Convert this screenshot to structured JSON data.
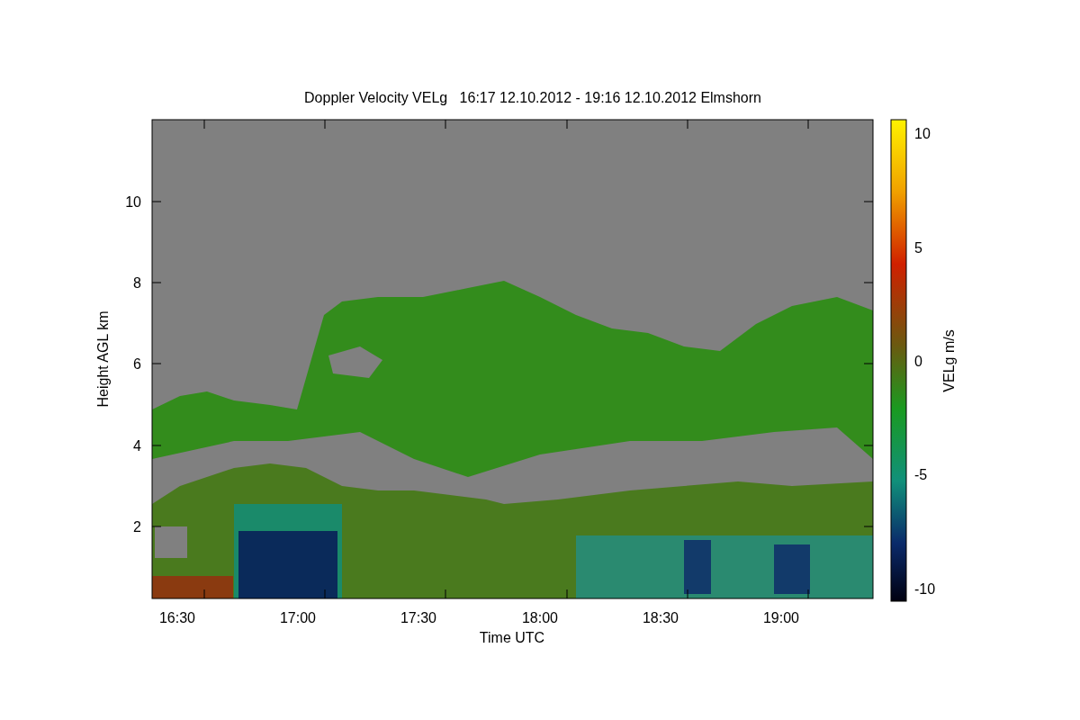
{
  "title": "Doppler Velocity VELg   16:17 12.10.2012 - 19:16 12.10.2012 Elmshorn",
  "xlabel": "Time UTC",
  "ylabel": "Height AGL km",
  "xticks": [
    "16:30",
    "17:00",
    "17:30",
    "18:00",
    "18:30",
    "19:00"
  ],
  "yticks": [
    "10",
    "8",
    "6",
    "4",
    "2"
  ],
  "colorbar": {
    "label": "VELg m/s",
    "ticks": [
      "10",
      "5",
      "0",
      "-5",
      "-10"
    ]
  }
}
